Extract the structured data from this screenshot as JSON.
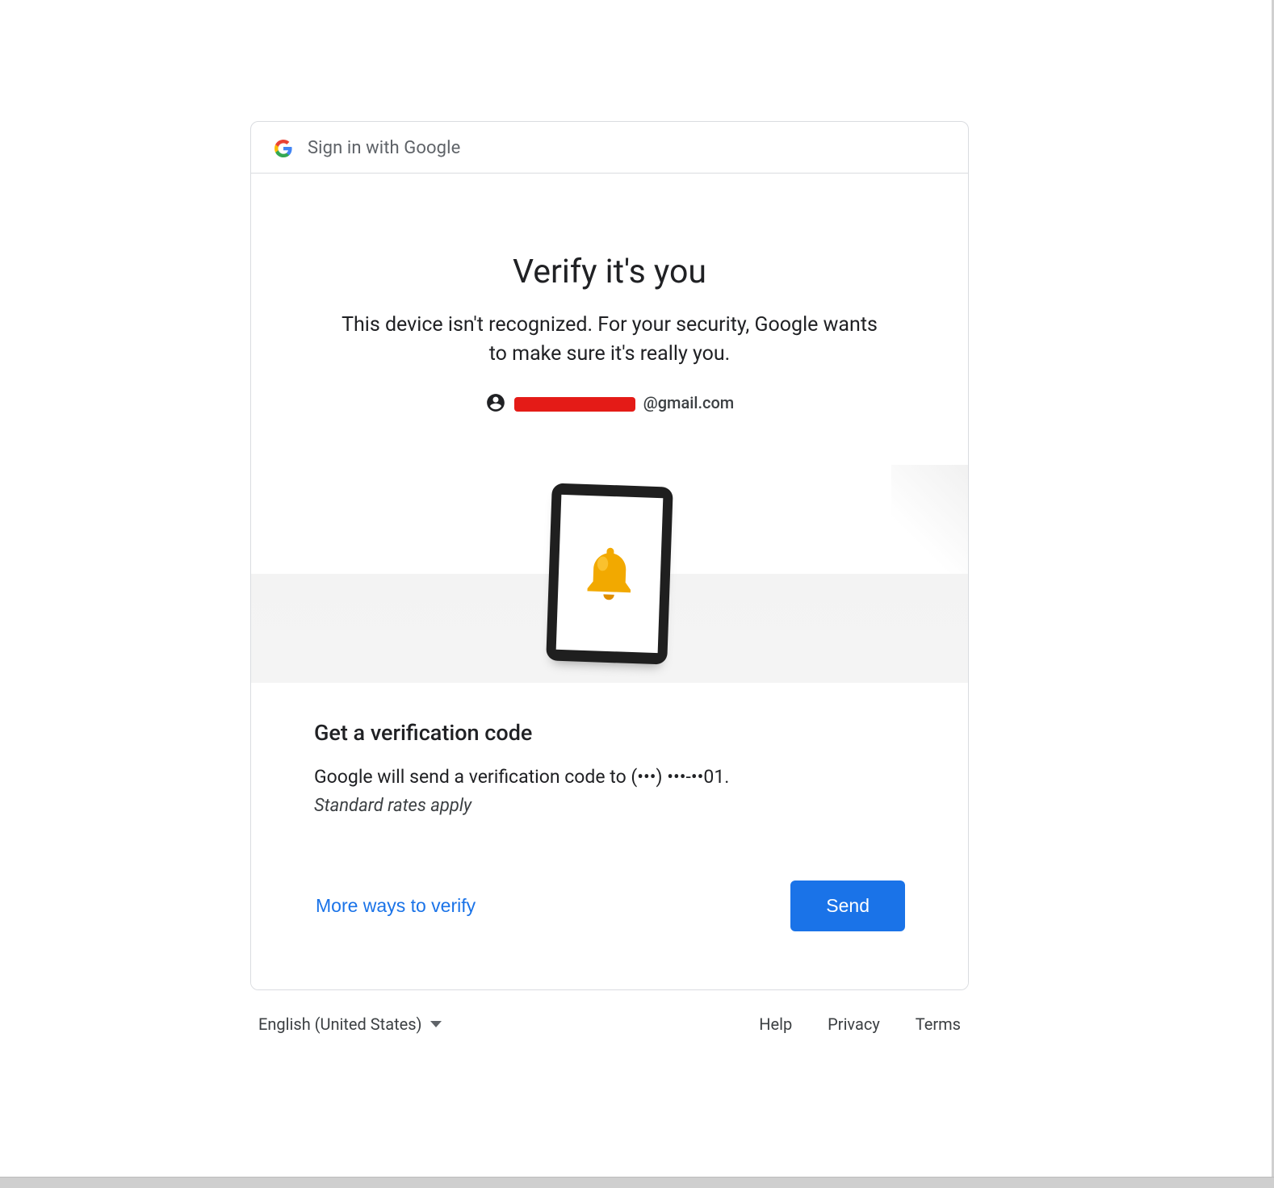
{
  "header": {
    "brand_label": "Sign in with Google"
  },
  "title": {
    "heading": "Verify it's you",
    "subtitle": "This device isn't recognized. For your security, Google wants to make sure it's really you."
  },
  "account": {
    "email_suffix": "@gmail.com"
  },
  "verification": {
    "section_title": "Get a verification code",
    "description": "Google will send a verification code to (•••) •••-••01.",
    "note": "Standard rates apply"
  },
  "actions": {
    "more_ways": "More ways to verify",
    "send": "Send"
  },
  "footer": {
    "language": "English (United States)",
    "links": {
      "help": "Help",
      "privacy": "Privacy",
      "terms": "Terms"
    }
  }
}
